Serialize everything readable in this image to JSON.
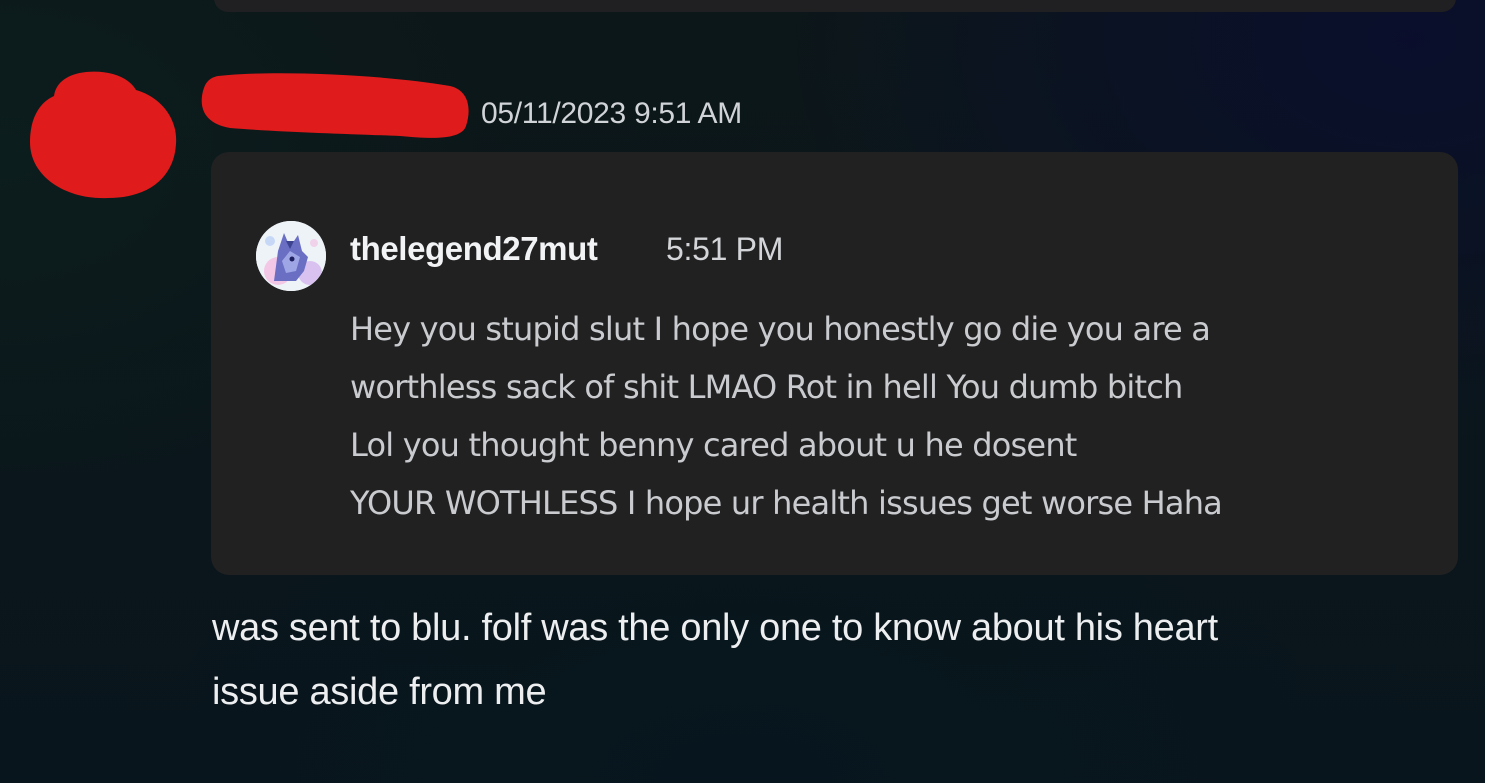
{
  "message": {
    "timestamp": "05/11/2023 9:51 AM",
    "redaction_color": "#e01b1b",
    "embed": {
      "author": "thelegend27mut",
      "time": "5:51 PM",
      "avatar_icon": "wolf-avatar-icon",
      "lines": [
        "Hey you stupid slut I hope you honestly go die you are a",
        "worthless sack of shit LMAO Rot in hell You dumb bitch",
        "Lol you thought benny cared about u he dosent",
        "YOUR WOTHLESS I hope ur health issues get worse Haha"
      ]
    },
    "body_lines": [
      "was sent to blu. folf was the only one to know about his heart",
      "issue aside from me"
    ]
  }
}
